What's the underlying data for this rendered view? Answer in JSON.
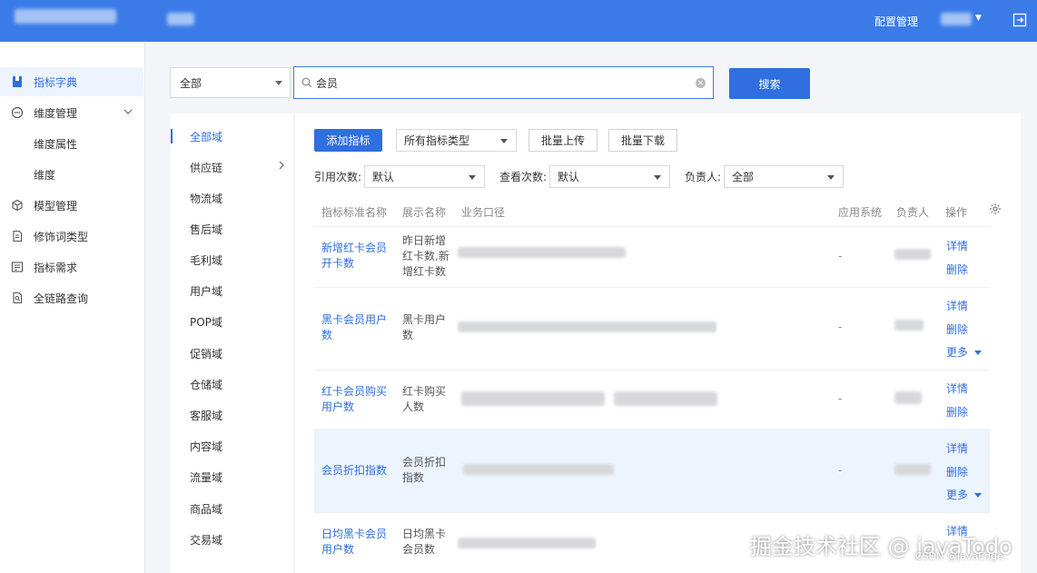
{
  "topbar": {
    "config_label": "配置管理",
    "exit_icon": "exit-icon"
  },
  "sidebar": {
    "items": [
      {
        "label": "指标字典",
        "icon": "bookmark-icon",
        "active": true
      },
      {
        "label": "维度管理",
        "icon": "dimension-icon"
      },
      {
        "label": "维度属性"
      },
      {
        "label": "维度"
      },
      {
        "label": "模型管理",
        "icon": "cube-icon"
      },
      {
        "label": "修饰词类型",
        "icon": "document-icon"
      },
      {
        "label": "指标需求",
        "icon": "list-icon"
      },
      {
        "label": "全链路查询",
        "icon": "search-doc-icon"
      }
    ]
  },
  "search": {
    "scope": "全部",
    "query": "会员",
    "button": "搜索"
  },
  "domains": [
    "全部域",
    "供应链",
    "物流域",
    "售后域",
    "毛利域",
    "用户域",
    "POP域",
    "促销域",
    "仓储域",
    "客服域",
    "内容域",
    "流量域",
    "商品域",
    "交易域"
  ],
  "toolbar": {
    "add": "添加指标",
    "type_select": "所有指标类型",
    "upload": "批量上传",
    "download": "批量下载"
  },
  "filters": {
    "ref_label": "引用次数:",
    "ref_value": "默认",
    "view_label": "查看次数:",
    "view_value": "默认",
    "owner_label": "负责人:",
    "owner_value": "全部"
  },
  "table": {
    "headers": [
      "指标标准名称",
      "展示名称",
      "业务口径",
      "应用系统",
      "负责人",
      "操作"
    ],
    "rows": [
      {
        "name": "新增红卡会员开卡数",
        "display": "昨日新增红卡数,新增红卡数",
        "system": "-",
        "ops": [
          "详情",
          "删除"
        ]
      },
      {
        "name": "黑卡会员用户数",
        "display": "黑卡用户数",
        "system": "-",
        "ops": [
          "详情",
          "删除",
          "更多"
        ]
      },
      {
        "name": "红卡会员购买用户数",
        "display": "红卡购买人数",
        "system": "-",
        "ops": [
          "详情",
          "删除"
        ]
      },
      {
        "name": "会员折扣指数",
        "display": "会员折扣指数",
        "system": "-",
        "ops": [
          "详情",
          "删除",
          "更多"
        ]
      },
      {
        "name": "日均黑卡会员用户数",
        "display": "日均黑卡会员数",
        "system": "",
        "ops": [
          "详情"
        ]
      }
    ]
  },
  "watermark": {
    "main": "掘金技术社区 @ javaTodo",
    "sub": "CSDN @JavaEdge."
  },
  "colors": {
    "primary": "#2f6fe0",
    "topbar": "#3a7be8",
    "highlight": "#ecf4fe"
  }
}
